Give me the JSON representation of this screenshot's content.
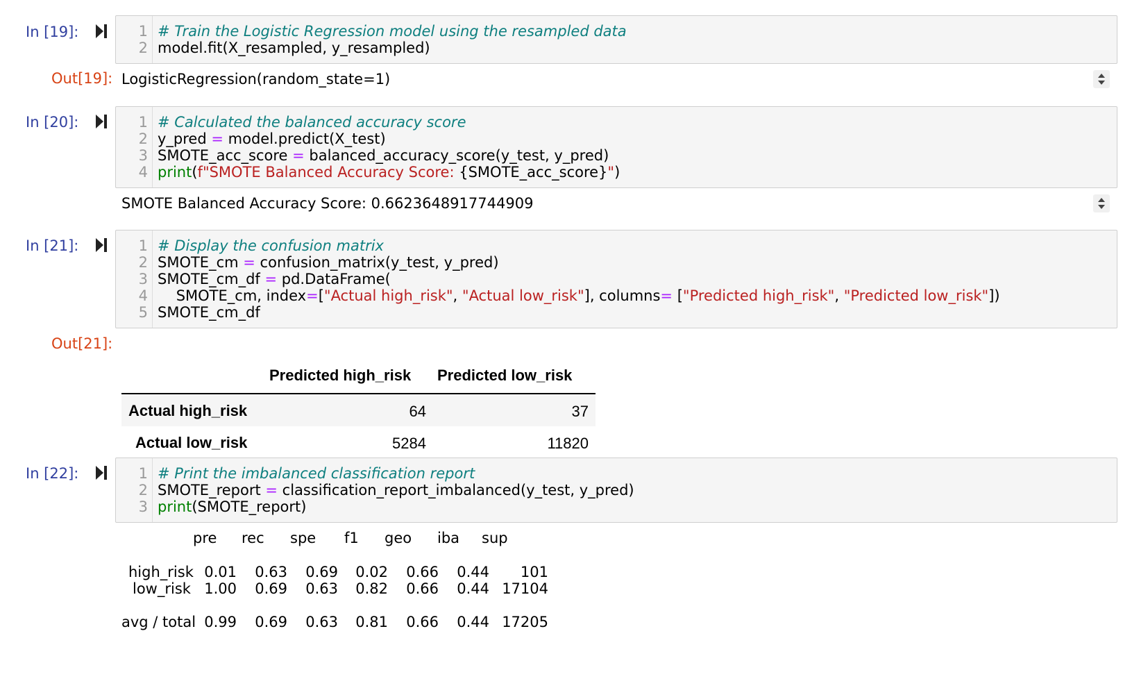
{
  "cells": [
    {
      "in_prompt": "In [19]:",
      "lines": [
        {
          "n": "1",
          "parts": [
            {
              "t": "# Train the Logistic Regression model using the resampled data",
              "c": "cm"
            }
          ]
        },
        {
          "n": "2",
          "parts": [
            {
              "t": "model.fit(X_resampled, y_resampled)",
              "c": ""
            }
          ]
        }
      ],
      "out_prompt": "Out[19]:",
      "output_text": "LogisticRegression(random_state=1)"
    },
    {
      "in_prompt": "In [20]:",
      "lines": [
        {
          "n": "1",
          "parts": [
            {
              "t": "# Calculated the balanced accuracy score",
              "c": "cm"
            }
          ]
        },
        {
          "n": "2",
          "parts": [
            {
              "t": "y_pred ",
              "c": ""
            },
            {
              "t": "=",
              "c": "op"
            },
            {
              "t": " model.predict(X_test)",
              "c": ""
            }
          ]
        },
        {
          "n": "3",
          "parts": [
            {
              "t": "SMOTE_acc_score ",
              "c": ""
            },
            {
              "t": "=",
              "c": "op"
            },
            {
              "t": " balanced_accuracy_score(y_test, y_pred)",
              "c": ""
            }
          ]
        },
        {
          "n": "4",
          "parts": [
            {
              "t": "print",
              "c": "bi"
            },
            {
              "t": "(",
              "c": ""
            },
            {
              "t": "f\"SMOTE Balanced Accuracy Score: ",
              "c": "str"
            },
            {
              "t": "{SMOTE_acc_score}",
              "c": ""
            },
            {
              "t": "\"",
              "c": "str"
            },
            {
              "t": ")",
              "c": ""
            }
          ]
        }
      ],
      "output_text": "SMOTE Balanced Accuracy Score: 0.6623648917744909"
    },
    {
      "in_prompt": "In [21]:",
      "lines": [
        {
          "n": "1",
          "parts": [
            {
              "t": "# Display the confusion matrix",
              "c": "cm"
            }
          ]
        },
        {
          "n": "2",
          "parts": [
            {
              "t": "SMOTE_cm ",
              "c": ""
            },
            {
              "t": "=",
              "c": "op"
            },
            {
              "t": " confusion_matrix(y_test, y_pred)",
              "c": ""
            }
          ]
        },
        {
          "n": "3",
          "parts": [
            {
              "t": "SMOTE_cm_df ",
              "c": ""
            },
            {
              "t": "=",
              "c": "op"
            },
            {
              "t": " pd.DataFrame(",
              "c": ""
            }
          ]
        },
        {
          "n": "4",
          "parts": [
            {
              "t": "    SMOTE_cm, index",
              "c": ""
            },
            {
              "t": "=",
              "c": "op"
            },
            {
              "t": "[",
              "c": ""
            },
            {
              "t": "\"Actual high_risk\"",
              "c": "str"
            },
            {
              "t": ", ",
              "c": ""
            },
            {
              "t": "\"Actual low_risk\"",
              "c": "str"
            },
            {
              "t": "], columns",
              "c": ""
            },
            {
              "t": "=",
              "c": "op"
            },
            {
              "t": " [",
              "c": ""
            },
            {
              "t": "\"Predicted high_risk\"",
              "c": "str"
            },
            {
              "t": ", ",
              "c": ""
            },
            {
              "t": "\"Predicted low_risk\"",
              "c": "str"
            },
            {
              "t": "])",
              "c": ""
            }
          ]
        },
        {
          "n": "5",
          "parts": [
            {
              "t": "SMOTE_cm_df",
              "c": ""
            }
          ]
        }
      ],
      "out_prompt": "Out[21]:"
    },
    {
      "in_prompt": "In [22]:",
      "lines": [
        {
          "n": "1",
          "parts": [
            {
              "t": "# Print the imbalanced classification report",
              "c": "cm"
            }
          ]
        },
        {
          "n": "2",
          "parts": [
            {
              "t": "SMOTE_report ",
              "c": ""
            },
            {
              "t": "=",
              "c": "op"
            },
            {
              "t": " classification_report_imbalanced(y_test, y_pred)",
              "c": ""
            }
          ]
        },
        {
          "n": "3",
          "parts": [
            {
              "t": "print",
              "c": "bi"
            },
            {
              "t": "(SMOTE_report)",
              "c": ""
            }
          ]
        }
      ]
    }
  ],
  "confusion_df": {
    "columns": [
      "Predicted high_risk",
      "Predicted low_risk"
    ],
    "rows": [
      {
        "index": "Actual high_risk",
        "values": [
          "64",
          "37"
        ]
      },
      {
        "index": "Actual low_risk",
        "values": [
          "5284",
          "11820"
        ]
      }
    ]
  },
  "report": {
    "header": [
      "pre",
      "rec",
      "spe",
      "f1",
      "geo",
      "iba",
      "sup"
    ],
    "rows": [
      {
        "label": "high_risk",
        "values": [
          "0.01",
          "0.63",
          "0.69",
          "0.02",
          "0.66",
          "0.44",
          "101"
        ]
      },
      {
        "label": "low_risk",
        "values": [
          "1.00",
          "0.69",
          "0.63",
          "0.82",
          "0.66",
          "0.44",
          "17104"
        ]
      },
      {
        "label": "avg / total",
        "values": [
          "0.99",
          "0.69",
          "0.63",
          "0.81",
          "0.66",
          "0.44",
          "17205"
        ]
      }
    ]
  },
  "colors": {
    "in_prompt": "#303f9f",
    "out_prompt": "#d84315",
    "comment": "#0e7f7f",
    "operator": "#aa22ff",
    "string": "#ba2121",
    "builtin": "#008000"
  },
  "icons": {
    "run": "run-cell-icon",
    "scroll": "scroll-toggle-icon"
  }
}
